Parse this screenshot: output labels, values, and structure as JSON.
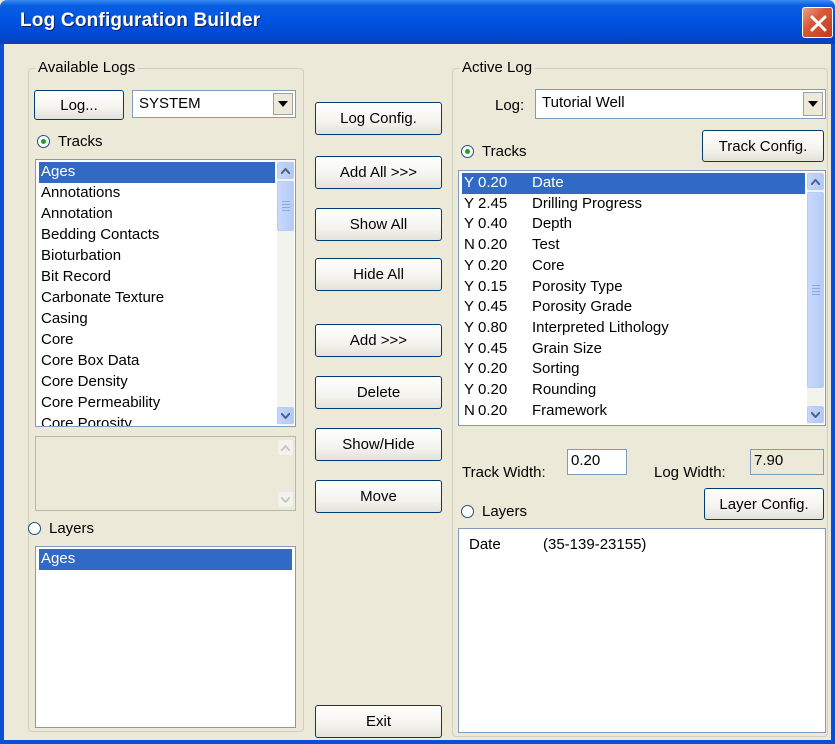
{
  "window": {
    "title": "Log Configuration Builder"
  },
  "available": {
    "group_label": "Available Logs",
    "log_button": "Log...",
    "log_combo_value": "SYSTEM",
    "tracks_radio": "Tracks",
    "tracks": [
      "Ages",
      "Annotations",
      "Annotation",
      "Bedding Contacts",
      "Bioturbation",
      "Bit Record",
      "Carbonate Texture",
      "Casing",
      "Core",
      "Core Box Data",
      "Core Density",
      "Core Permeability",
      "Core Porosity"
    ],
    "layers_radio": "Layers",
    "layers": [
      "Ages"
    ]
  },
  "middle": {
    "log_config": "Log Config.",
    "add_all": "Add All >>>",
    "show_all": "Show All",
    "hide_all": "Hide All",
    "add": "Add >>>",
    "delete": "Delete",
    "show_hide": "Show/Hide",
    "move": "Move",
    "exit": "Exit"
  },
  "active": {
    "group_label": "Active Log",
    "log_label": "Log:",
    "log_combo_value": "Tutorial Well",
    "tracks_radio": "Tracks",
    "track_config": "Track Config.",
    "tracks": [
      {
        "flag": "Y",
        "width": "0.20",
        "name": "Date"
      },
      {
        "flag": "Y",
        "width": "2.45",
        "name": "Drilling Progress"
      },
      {
        "flag": "Y",
        "width": "0.40",
        "name": "Depth"
      },
      {
        "flag": "N",
        "width": "0.20",
        "name": "Test"
      },
      {
        "flag": "Y",
        "width": "0.20",
        "name": "Core"
      },
      {
        "flag": "Y",
        "width": "0.15",
        "name": "Porosity Type"
      },
      {
        "flag": "Y",
        "width": "0.45",
        "name": "Porosity Grade"
      },
      {
        "flag": "Y",
        "width": "0.80",
        "name": "Interpreted Lithology"
      },
      {
        "flag": "Y",
        "width": "0.45",
        "name": "Grain Size"
      },
      {
        "flag": "Y",
        "width": "0.20",
        "name": "Sorting"
      },
      {
        "flag": "Y",
        "width": "0.20",
        "name": "Rounding"
      },
      {
        "flag": "N",
        "width": "0.20",
        "name": "Framework"
      }
    ],
    "track_width_label": "Track Width:",
    "track_width_value": "0.20",
    "log_width_label": "Log Width:",
    "log_width_value": "7.90",
    "layers_radio": "Layers",
    "layer_config": "Layer Config.",
    "layers": [
      {
        "name": "Date",
        "detail": "(35-139-23155)"
      }
    ]
  },
  "colors": {
    "selection": "#316ac5",
    "titlebar": "#0054e3",
    "face": "#ece9d8"
  }
}
